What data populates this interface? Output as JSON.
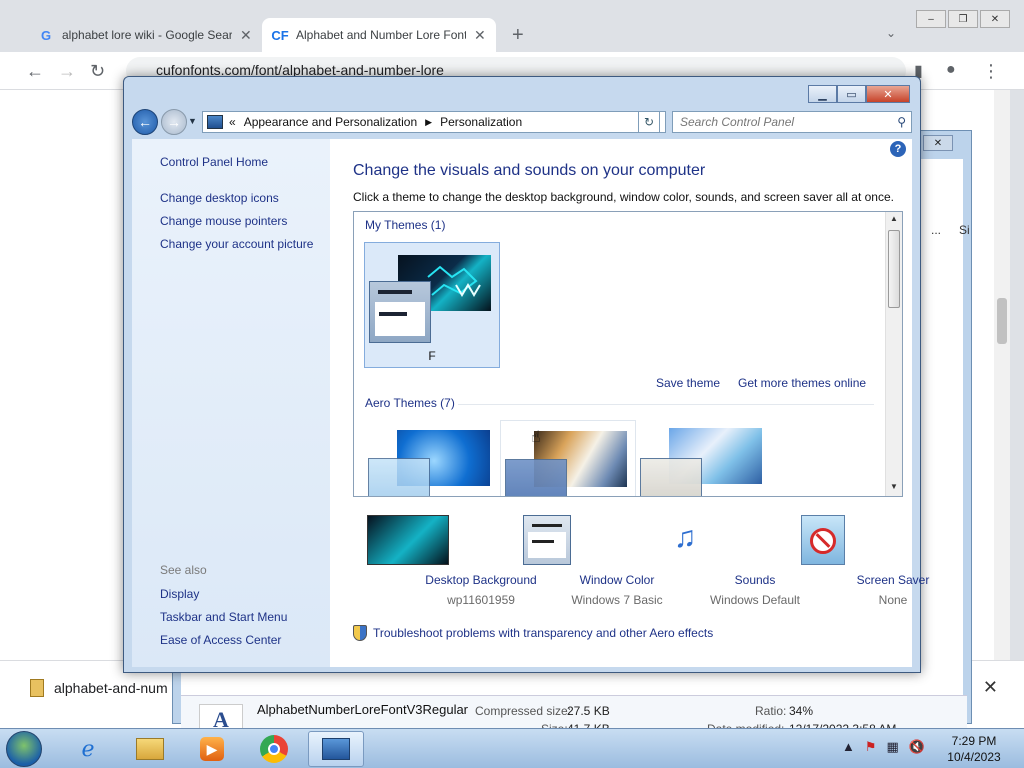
{
  "browser": {
    "tabs": [
      {
        "label": "alphabet lore wiki - Google Searc",
        "favicon": "G"
      },
      {
        "label": "Alphabet and Number Lore Font",
        "favicon": "CF"
      }
    ],
    "url": "cufonfonts.com/font/alphabet-and-number-lore",
    "new_tab": "+",
    "download_item": "alphabet-and-num"
  },
  "archive": {
    "filename": "AlphabetNumberLoreFontV3Regular",
    "compressed_label": "Compressed size:",
    "compressed_value": "27.5 KB",
    "size_label": "Size:",
    "size_value": "41.7 KB",
    "ratio_label": "Ratio:",
    "ratio_value": "34%",
    "modified_label": "Date modified:",
    "modified_value": "12/17/2022 3:58 AM",
    "col_fragment": "Si",
    "dots": "..."
  },
  "cp": {
    "breadcrumb_prefix": "«",
    "crumbs": [
      "Appearance and Personalization",
      "Personalization"
    ],
    "search_placeholder": "Search Control Panel",
    "left_links": [
      "Control Panel Home",
      "Change desktop icons",
      "Change mouse pointers",
      "Change your account picture"
    ],
    "see_also_title": "See also",
    "see_also_links": [
      "Display",
      "Taskbar and Start Menu",
      "Ease of Access Center"
    ],
    "heading": "Change the visuals and sounds on your computer",
    "subtext": "Click a theme to change the desktop background, window color, sounds, and screen saver all at once.",
    "my_themes_label": "My Themes (1)",
    "my_theme_name": "F",
    "save_theme": "Save theme",
    "get_more": "Get more themes online",
    "aero_label": "Aero Themes (7)",
    "settings": [
      {
        "label": "Desktop Background",
        "value": "wp11601959",
        "icon": "wallpaper-icon"
      },
      {
        "label": "Window Color",
        "value": "Windows 7 Basic",
        "icon": "window-color-icon"
      },
      {
        "label": "Sounds",
        "value": "Windows Default",
        "icon": "sounds-icon"
      },
      {
        "label": "Screen Saver",
        "value": "None",
        "icon": "screen-saver-icon"
      }
    ],
    "troubleshoot": "Troubleshoot problems with transparency and other Aero effects"
  },
  "taskbar": {
    "time": "7:29 PM",
    "date": "10/4/2023"
  }
}
